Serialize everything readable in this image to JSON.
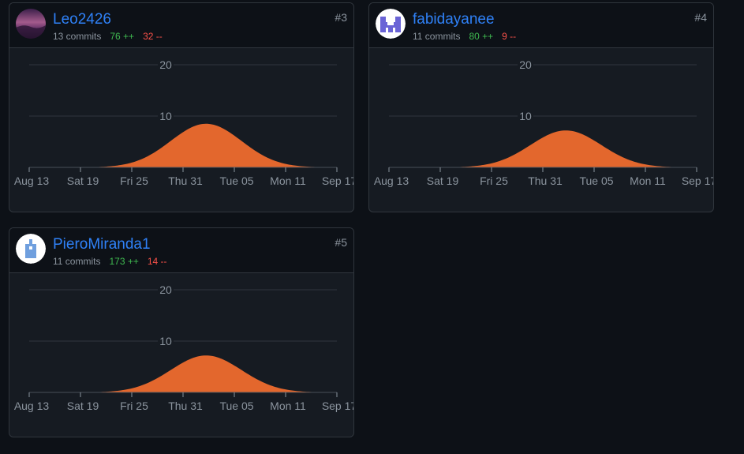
{
  "contributors": [
    {
      "username": "Leo2426",
      "commits": "13 commits",
      "additions": "76 ++",
      "deletions": "32 --",
      "rank": "#3",
      "avatar_icon": "gradient-avatar-icon",
      "peak_commits": 8.5
    },
    {
      "username": "fabidayanee",
      "commits": "11 commits",
      "additions": "80 ++",
      "deletions": "9 --",
      "rank": "#4",
      "avatar_icon": "identicon-avatar-icon",
      "peak_commits": 7.2
    },
    {
      "username": "PieroMiranda1",
      "commits": "11 commits",
      "additions": "173 ++",
      "deletions": "14 --",
      "rank": "#5",
      "avatar_icon": "identicon-avatar-icon",
      "peak_commits": 7.2
    }
  ],
  "chart_data": {
    "type": "area",
    "x_tick_labels": [
      "Aug 13",
      "Sat 19",
      "Fri 25",
      "Thu 31",
      "Tue 05",
      "Mon 11",
      "Sep 17"
    ],
    "y_tick_labels": [
      "10",
      "20"
    ],
    "ylim": [
      0,
      20
    ],
    "grid": true,
    "series_color": "#e3672d"
  },
  "colors": {
    "background": "#0d1117",
    "card": "#161b22",
    "border": "#30363d",
    "link": "#2f81f7",
    "additions": "#3fb950",
    "deletions": "#f85149",
    "area": "#e3672d"
  }
}
